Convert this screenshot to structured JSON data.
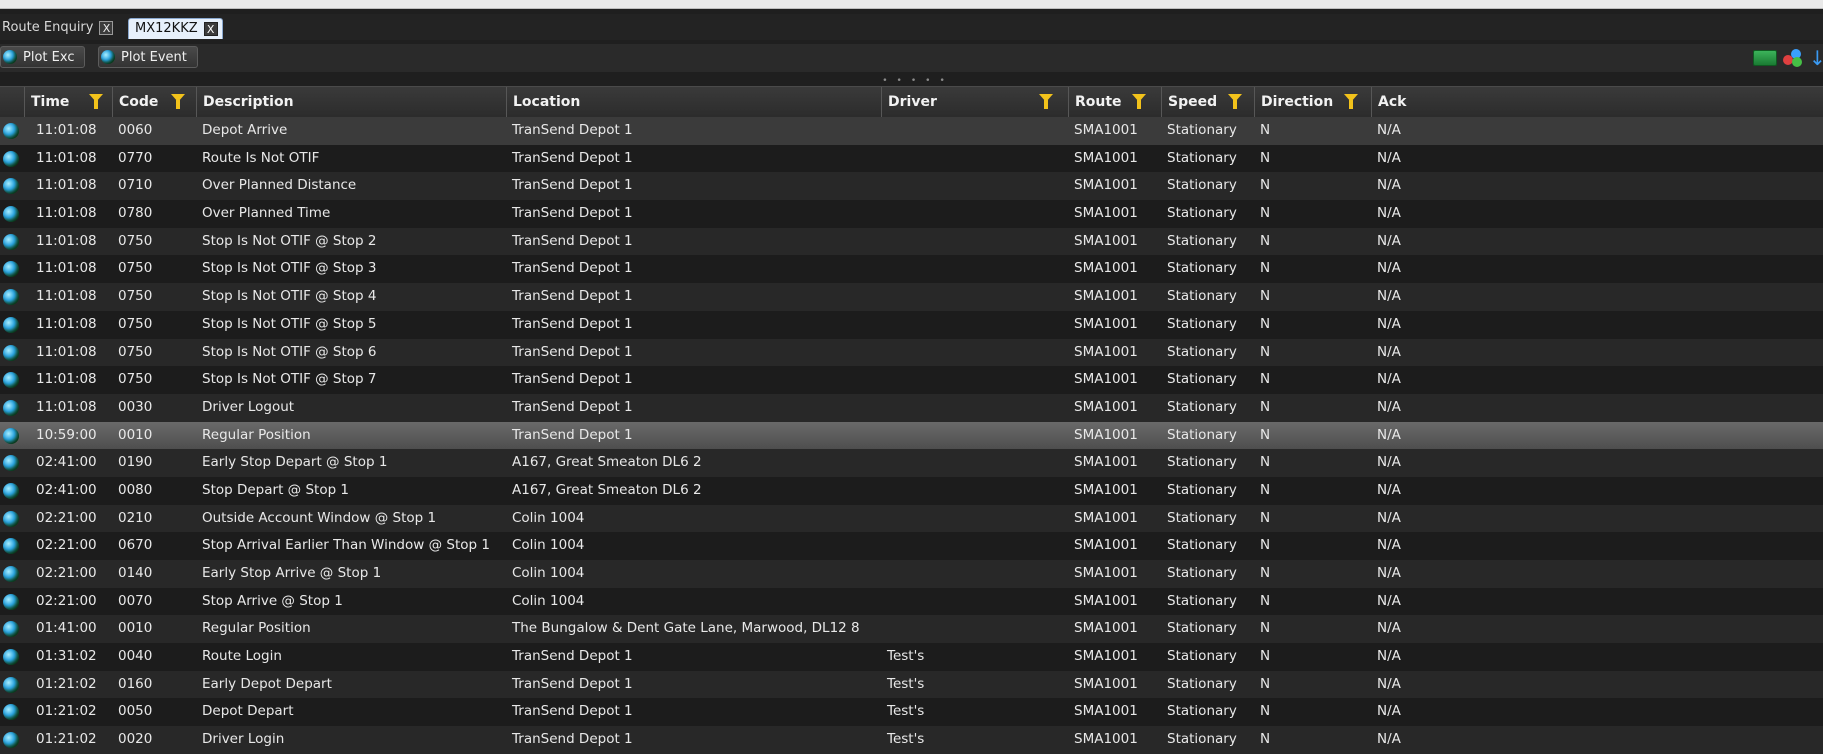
{
  "tabs": [
    {
      "label": "Route Enquiry"
    },
    {
      "label": "MX12KKZ"
    }
  ],
  "tab_close_glyph": "X",
  "toolbar": {
    "plot_exc_label": "Plot Exc",
    "plot_event_label": "Plot Event"
  },
  "columns": {
    "time": "Time",
    "code": "Code",
    "description": "Description",
    "location": "Location",
    "driver": "Driver",
    "route": "Route",
    "speed": "Speed",
    "direction": "Direction",
    "ack": "Ack"
  },
  "colors": {
    "filter_icon": "#f2c21b",
    "background": "#1f1f1f",
    "row_highlight": "#5c5c5c"
  },
  "icons": [
    "globe-icon",
    "filter-icon",
    "close-icon",
    "grid-view-icon",
    "cluster-icon",
    "download-arrow-icon"
  ],
  "rows": [
    {
      "time": "11:01:08",
      "code": "0060",
      "description": "Depot Arrive",
      "location": "TranSend Depot 1",
      "driver": "",
      "route": "SMA1001",
      "speed": "Stationary",
      "direction": "N",
      "ack": "N/A"
    },
    {
      "time": "11:01:08",
      "code": "0770",
      "description": "Route Is Not OTIF",
      "location": "TranSend Depot 1",
      "driver": "",
      "route": "SMA1001",
      "speed": "Stationary",
      "direction": "N",
      "ack": "N/A"
    },
    {
      "time": "11:01:08",
      "code": "0710",
      "description": "Over Planned Distance",
      "location": "TranSend Depot 1",
      "driver": "",
      "route": "SMA1001",
      "speed": "Stationary",
      "direction": "N",
      "ack": "N/A"
    },
    {
      "time": "11:01:08",
      "code": "0780",
      "description": "Over Planned Time",
      "location": "TranSend Depot 1",
      "driver": "",
      "route": "SMA1001",
      "speed": "Stationary",
      "direction": "N",
      "ack": "N/A"
    },
    {
      "time": "11:01:08",
      "code": "0750",
      "description": "Stop Is Not OTIF @ Stop 2",
      "location": "TranSend Depot 1",
      "driver": "",
      "route": "SMA1001",
      "speed": "Stationary",
      "direction": "N",
      "ack": "N/A"
    },
    {
      "time": "11:01:08",
      "code": "0750",
      "description": "Stop Is Not OTIF @ Stop 3",
      "location": "TranSend Depot 1",
      "driver": "",
      "route": "SMA1001",
      "speed": "Stationary",
      "direction": "N",
      "ack": "N/A"
    },
    {
      "time": "11:01:08",
      "code": "0750",
      "description": "Stop Is Not OTIF @ Stop 4",
      "location": "TranSend Depot 1",
      "driver": "",
      "route": "SMA1001",
      "speed": "Stationary",
      "direction": "N",
      "ack": "N/A"
    },
    {
      "time": "11:01:08",
      "code": "0750",
      "description": "Stop Is Not OTIF @ Stop 5",
      "location": "TranSend Depot 1",
      "driver": "",
      "route": "SMA1001",
      "speed": "Stationary",
      "direction": "N",
      "ack": "N/A"
    },
    {
      "time": "11:01:08",
      "code": "0750",
      "description": "Stop Is Not OTIF @ Stop 6",
      "location": "TranSend Depot 1",
      "driver": "",
      "route": "SMA1001",
      "speed": "Stationary",
      "direction": "N",
      "ack": "N/A"
    },
    {
      "time": "11:01:08",
      "code": "0750",
      "description": "Stop Is Not OTIF @ Stop 7",
      "location": "TranSend Depot 1",
      "driver": "",
      "route": "SMA1001",
      "speed": "Stationary",
      "direction": "N",
      "ack": "N/A"
    },
    {
      "time": "11:01:08",
      "code": "0030",
      "description": "Driver Logout",
      "location": "TranSend Depot 1",
      "driver": "",
      "route": "SMA1001",
      "speed": "Stationary",
      "direction": "N",
      "ack": "N/A"
    },
    {
      "time": "10:59:00",
      "code": "0010",
      "description": "Regular Position",
      "location": "TranSend Depot 1",
      "driver": "",
      "route": "SMA1001",
      "speed": "Stationary",
      "direction": "N",
      "ack": "N/A"
    },
    {
      "time": "02:41:00",
      "code": "0190",
      "description": "Early Stop Depart @ Stop 1",
      "location": "A167, Great Smeaton DL6 2",
      "driver": "",
      "route": "SMA1001",
      "speed": "Stationary",
      "direction": "N",
      "ack": "N/A"
    },
    {
      "time": "02:41:00",
      "code": "0080",
      "description": "Stop Depart @ Stop 1",
      "location": "A167, Great Smeaton DL6 2",
      "driver": "",
      "route": "SMA1001",
      "speed": "Stationary",
      "direction": "N",
      "ack": "N/A"
    },
    {
      "time": "02:21:00",
      "code": "0210",
      "description": "Outside Account Window @ Stop 1",
      "location": "Colin 1004",
      "driver": "",
      "route": "SMA1001",
      "speed": "Stationary",
      "direction": "N",
      "ack": "N/A"
    },
    {
      "time": "02:21:00",
      "code": "0670",
      "description": "Stop Arrival Earlier Than Window @ Stop 1",
      "location": "Colin 1004",
      "driver": "",
      "route": "SMA1001",
      "speed": "Stationary",
      "direction": "N",
      "ack": "N/A"
    },
    {
      "time": "02:21:00",
      "code": "0140",
      "description": "Early Stop Arrive @ Stop 1",
      "location": "Colin 1004",
      "driver": "",
      "route": "SMA1001",
      "speed": "Stationary",
      "direction": "N",
      "ack": "N/A"
    },
    {
      "time": "02:21:00",
      "code": "0070",
      "description": "Stop Arrive @ Stop 1",
      "location": "Colin 1004",
      "driver": "",
      "route": "SMA1001",
      "speed": "Stationary",
      "direction": "N",
      "ack": "N/A"
    },
    {
      "time": "01:41:00",
      "code": "0010",
      "description": "Regular Position",
      "location": "The Bungalow & Dent Gate Lane, Marwood, DL12 8",
      "driver": "",
      "route": "SMA1001",
      "speed": "Stationary",
      "direction": "N",
      "ack": "N/A"
    },
    {
      "time": "01:31:02",
      "code": "0040",
      "description": "Route Login",
      "location": "TranSend Depot 1",
      "driver": "Test's",
      "route": "SMA1001",
      "speed": "Stationary",
      "direction": "N",
      "ack": "N/A"
    },
    {
      "time": "01:21:02",
      "code": "0160",
      "description": "Early Depot Depart",
      "location": "TranSend Depot 1",
      "driver": "Test's",
      "route": "SMA1001",
      "speed": "Stationary",
      "direction": "N",
      "ack": "N/A"
    },
    {
      "time": "01:21:02",
      "code": "0050",
      "description": "Depot Depart",
      "location": "TranSend Depot 1",
      "driver": "Test's",
      "route": "SMA1001",
      "speed": "Stationary",
      "direction": "N",
      "ack": "N/A"
    },
    {
      "time": "01:21:02",
      "code": "0020",
      "description": "Driver Login",
      "location": "TranSend Depot 1",
      "driver": "Test's",
      "route": "SMA1001",
      "speed": "Stationary",
      "direction": "N",
      "ack": "N/A"
    }
  ],
  "selected_row_index": 11
}
